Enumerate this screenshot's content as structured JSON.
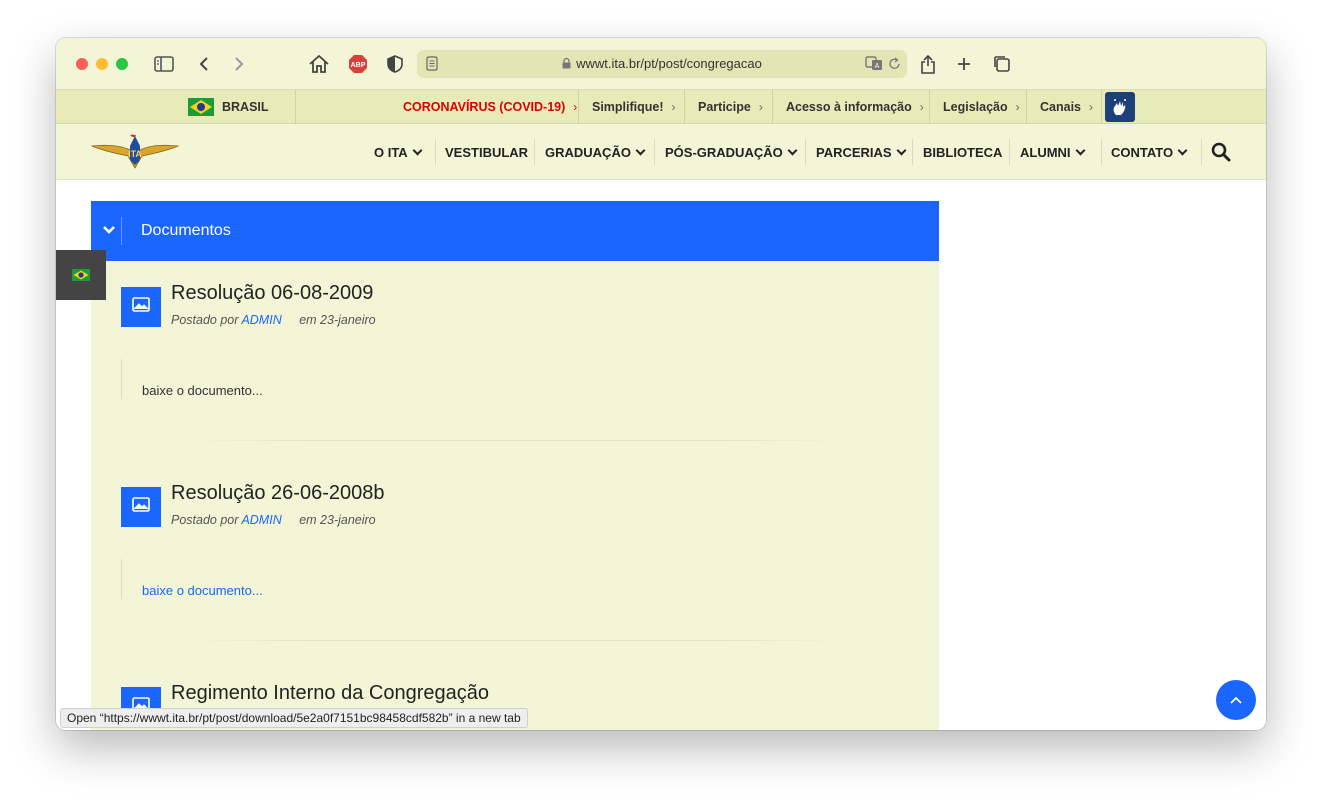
{
  "browser": {
    "url": "wwwt.ita.br/pt/post/congregacao",
    "status_link_prefix": "Open “",
    "status_link_url": "https://wwwt.ita.br/pt/post/download/5e2a0f7151bc98458cdf582b",
    "status_link_suffix": "” in a new tab",
    "icons": [
      "sidebar-icon",
      "back-icon",
      "forward-icon",
      "home-icon",
      "adblock-icon",
      "shield-icon",
      "reader-icon",
      "lock-icon",
      "translate-icon",
      "reload-icon",
      "share-icon",
      "new-tab-icon",
      "tabs-icon"
    ],
    "adblock_label": "ABP"
  },
  "govbar": {
    "country": "BRASIL",
    "items": [
      {
        "label": "CORONAVÍRUS (COVID-19)",
        "highlight": true
      },
      {
        "label": "Simplifique!"
      },
      {
        "label": "Participe"
      },
      {
        "label": "Acesso à informação"
      },
      {
        "label": "Legislação"
      },
      {
        "label": "Canais"
      }
    ]
  },
  "nav": {
    "items": [
      {
        "label": "O ITA",
        "dropdown": true
      },
      {
        "label": "VESTIBULAR",
        "dropdown": false
      },
      {
        "label": "GRADUAÇÃO",
        "dropdown": true
      },
      {
        "label": "PÓS-GRADUAÇÃO",
        "dropdown": true
      },
      {
        "label": "PARCERIAS",
        "dropdown": true
      },
      {
        "label": "BIBLIOTECA",
        "dropdown": false
      },
      {
        "label": "ALUMNI",
        "dropdown": true
      },
      {
        "label": "CONTATO",
        "dropdown": true
      }
    ]
  },
  "documents": {
    "title": "Documentos",
    "posts": [
      {
        "title": "Resolução 06-08-2009",
        "posted_by": "Postado por",
        "author": "ADMIN",
        "date": "em 23-janeiro",
        "excerpt": "baixe o documento...",
        "excerpt_link": false
      },
      {
        "title": "Resolução 26-06-2008b",
        "posted_by": "Postado por",
        "author": "ADMIN",
        "date": "em 23-janeiro",
        "excerpt": "baixe o documento...",
        "excerpt_link": true
      },
      {
        "title": "Regimento Interno da Congregação"
      }
    ]
  },
  "colors": {
    "accent": "#1a66ff",
    "panel_bg": "#f2f5d6",
    "govbar_bg": "#e6ebb8",
    "covid_red": "#e00000"
  }
}
